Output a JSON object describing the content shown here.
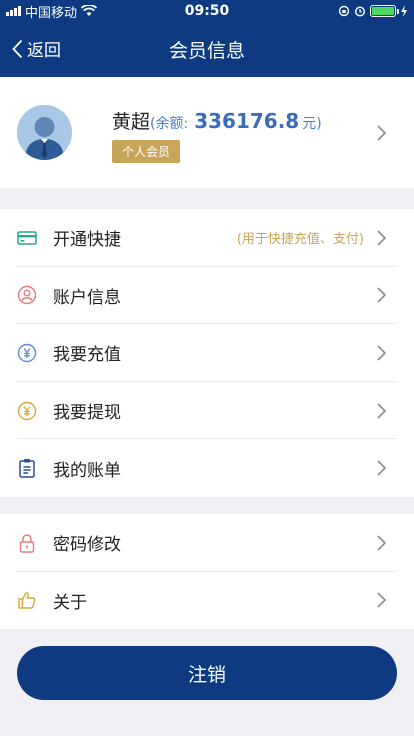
{
  "status": {
    "carrier": "中国移动",
    "time": "09:50",
    "battery_level": 1.0
  },
  "nav": {
    "title": "会员信息",
    "back_label": "返回"
  },
  "profile": {
    "name": "黄超",
    "balance_prefix": "(余额:",
    "balance_value": "336176.8",
    "balance_unit": "元)",
    "member_type": "个人会员"
  },
  "menu_group_1": [
    {
      "label": "开通快捷",
      "hint": "(用于快捷充值、支付)",
      "icon": "card-icon",
      "color": "#2ea69a"
    },
    {
      "label": "账户信息",
      "icon": "user-icon",
      "color": "#e87a7a"
    },
    {
      "label": "我要充值",
      "icon": "yuan-circle-icon",
      "color": "#5b8dd6"
    },
    {
      "label": "我要提现",
      "icon": "yuan-coin-icon",
      "color": "#d8a93a"
    },
    {
      "label": "我的账单",
      "icon": "clipboard-icon",
      "color": "#2c4f8a"
    }
  ],
  "menu_group_2": [
    {
      "label": "密码修改",
      "icon": "lock-icon",
      "color": "#e87a7a"
    },
    {
      "label": "关于",
      "icon": "thumbs-up-icon",
      "color": "#d8a93a"
    }
  ],
  "logout_label": "注销",
  "colors": {
    "primary": "#0d3a80",
    "gold": "#c9a55a",
    "balance": "#3a6db5"
  }
}
